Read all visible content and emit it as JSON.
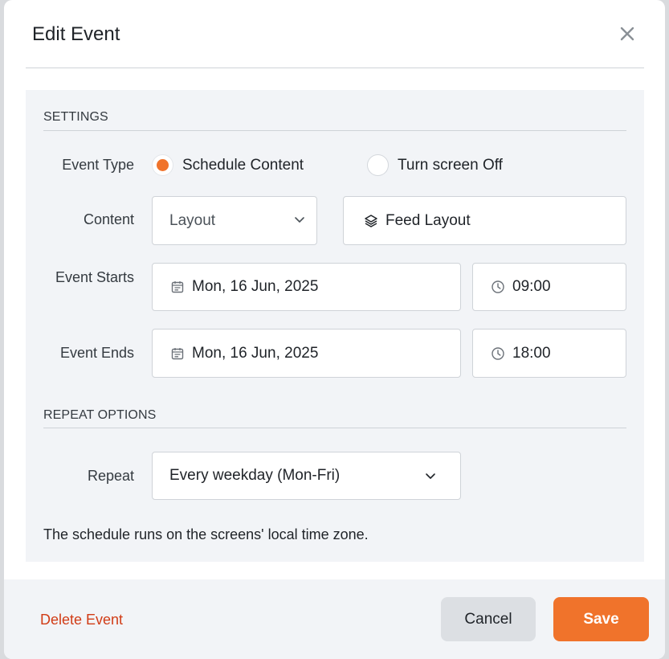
{
  "dialog": {
    "title": "Edit Event",
    "close_icon": "close-icon"
  },
  "settings": {
    "section_title": "SETTINGS",
    "event_type": {
      "label": "Event Type",
      "options": [
        {
          "label": "Schedule Content",
          "selected": true
        },
        {
          "label": "Turn screen Off",
          "selected": false
        }
      ]
    },
    "content": {
      "label": "Content",
      "type_value": "Layout",
      "type_icon": "chevron-down-icon",
      "item_value": "Feed Layout",
      "item_icon": "layers-icon"
    },
    "event_starts": {
      "label": "Event Starts",
      "date": "Mon, 16 Jun, 2025",
      "time": "09:00"
    },
    "event_ends": {
      "label": "Event Ends",
      "date": "Mon, 16 Jun, 2025",
      "time": "18:00"
    }
  },
  "repeat_options": {
    "section_title": "REPEAT OPTIONS",
    "repeat": {
      "label": "Repeat",
      "value": "Every weekday (Mon-Fri)"
    },
    "note": "The schedule runs on the screens' local time zone."
  },
  "footer": {
    "delete_label": "Delete Event",
    "cancel_label": "Cancel",
    "save_label": "Save"
  },
  "colors": {
    "accent": "#f0732b",
    "danger": "#d13c16",
    "panel_background": "#f2f4f7"
  }
}
